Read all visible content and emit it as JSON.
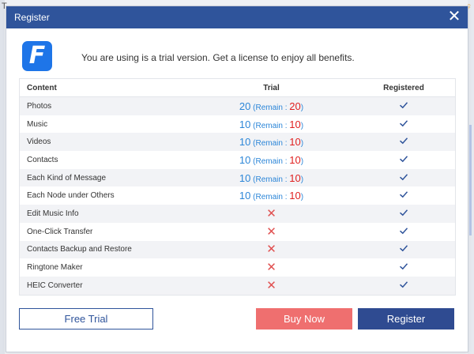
{
  "background": {
    "frag_left": "T",
    "frag_right": "♀"
  },
  "dialog": {
    "title": "Register",
    "close_glyph": "✕",
    "logo_letter": "F",
    "message": "You are using is a trial version. Get a license to enjoy all benefits."
  },
  "table": {
    "headers": {
      "content": "Content",
      "trial": "Trial",
      "registered": "Registered"
    },
    "rows": [
      {
        "content": "Photos",
        "trial_type": "limit",
        "trial_limit": "20",
        "remain_label": "(Remain : ",
        "remain_value": "20",
        "remain_close": ")",
        "registered": "check"
      },
      {
        "content": "Music",
        "trial_type": "limit",
        "trial_limit": "10",
        "remain_label": "(Remain : ",
        "remain_value": "10",
        "remain_close": ")",
        "registered": "check"
      },
      {
        "content": "Videos",
        "trial_type": "limit",
        "trial_limit": "10",
        "remain_label": "(Remain : ",
        "remain_value": "10",
        "remain_close": ")",
        "registered": "check"
      },
      {
        "content": "Contacts",
        "trial_type": "limit",
        "trial_limit": "10",
        "remain_label": "(Remain : ",
        "remain_value": "10",
        "remain_close": ")",
        "registered": "check"
      },
      {
        "content": "Each Kind of Message",
        "trial_type": "limit",
        "trial_limit": "10",
        "remain_label": "(Remain : ",
        "remain_value": "10",
        "remain_close": ")",
        "registered": "check"
      },
      {
        "content": "Each Node under  Others",
        "trial_type": "limit",
        "trial_limit": "10",
        "remain_label": "(Remain : ",
        "remain_value": "10",
        "remain_close": ")",
        "registered": "check"
      },
      {
        "content": "Edit Music Info",
        "trial_type": "unavailable",
        "unavailable_glyph": "✕",
        "registered": "check"
      },
      {
        "content": "One-Click Transfer",
        "trial_type": "unavailable",
        "unavailable_glyph": "✕",
        "registered": "check"
      },
      {
        "content": "Contacts Backup and Restore",
        "trial_type": "unavailable",
        "unavailable_glyph": "✕",
        "registered": "check"
      },
      {
        "content": "Ringtone Maker",
        "trial_type": "unavailable",
        "unavailable_glyph": "✕",
        "registered": "check"
      },
      {
        "content": "HEIC Converter",
        "trial_type": "unavailable",
        "unavailable_glyph": "✕",
        "registered": "check"
      }
    ]
  },
  "buttons": {
    "free_trial": "Free Trial",
    "buy_now": "Buy Now",
    "register": "Register"
  },
  "colors": {
    "title_bar": "#2f549b",
    "logo": "#1e75e8",
    "trial_limit": "#2c86d8",
    "remain_value": "#e02020",
    "unavailable": "#e05050",
    "check": "#2f549b",
    "buy_now": "#ef6f6f",
    "register": "#2f4b91"
  },
  "icons": {
    "close": "close-icon",
    "logo": "app-logo-icon",
    "check": "check-icon",
    "unavailable": "cross-icon"
  }
}
